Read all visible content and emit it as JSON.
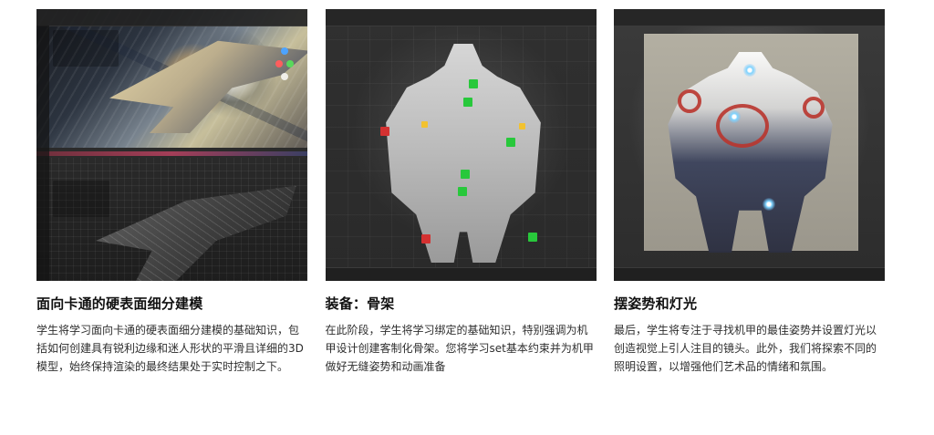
{
  "cards": [
    {
      "title": "面向卡通的硬表面细分建模",
      "description": "学生将学习面向卡通的硬表面细分建模的基础知识，包括如何创建具有锐利边缘和迷人形状的平滑且详细的3D 模型，始终保持渲染的最终结果处于实时控制之下。"
    },
    {
      "title": "装备：骨架",
      "description": "在此阶段，学生将学习绑定的基础知识，特别强调为机甲设计创建客制化骨架。您将学习set基本约束并为机甲做好无缝姿势和动画准备"
    },
    {
      "title": "摆姿势和灯光",
      "description": "最后，学生将专注于寻找机甲的最佳姿势并设置灯光以创造视觉上引人注目的镜头。此外，我们将探索不同的照明设置，以增强他们艺术品的情绪和氛围。"
    }
  ],
  "colors": {
    "accent_red": "#cf2f2f",
    "accent_green": "#3ad14c",
    "accent_yellow": "#f2c230",
    "accent_blue": "#43a6ff"
  },
  "icons": {
    "thumb1": "blender-hard-surface-preview",
    "thumb2": "blender-rig-preview",
    "thumb3": "blender-posing-lighting-preview"
  }
}
